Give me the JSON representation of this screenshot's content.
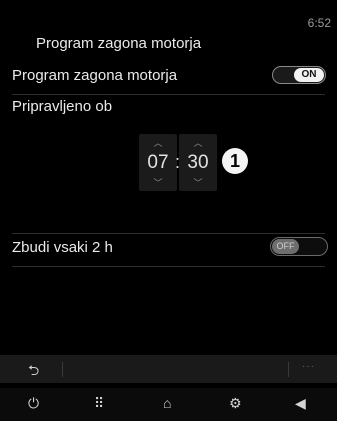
{
  "status": {
    "clock": "6:52"
  },
  "header": {
    "title": "Program zagona motorja"
  },
  "settings": {
    "engine_program": {
      "label": "Program zagona motorja",
      "toggle_text": "ON"
    },
    "ready_at": {
      "label": "Pripravljeno ob",
      "hour": "07",
      "minute": "30",
      "separator": ":"
    },
    "wake_every_2h": {
      "label": "Zbudi vsaki 2 h",
      "toggle_text": "OFF"
    }
  },
  "callout": {
    "number": "1"
  },
  "toolbar": {
    "back_icon": "back-arrow-icon",
    "more_icon": "more-dots-icon"
  },
  "navbar": {
    "items": [
      {
        "icon": "power-icon",
        "glyph": "⏻"
      },
      {
        "icon": "apps-grid-icon",
        "glyph": "⠿"
      },
      {
        "icon": "home-icon",
        "glyph": "⌂"
      },
      {
        "icon": "driving-assist-icon",
        "glyph": "⚙"
      },
      {
        "icon": "volume-icon",
        "glyph": "◀"
      }
    ]
  },
  "colors": {
    "background": "#000000",
    "toggle_on_knob": "#f2f2f2",
    "toggle_off_knob": "#6e6e6e"
  }
}
